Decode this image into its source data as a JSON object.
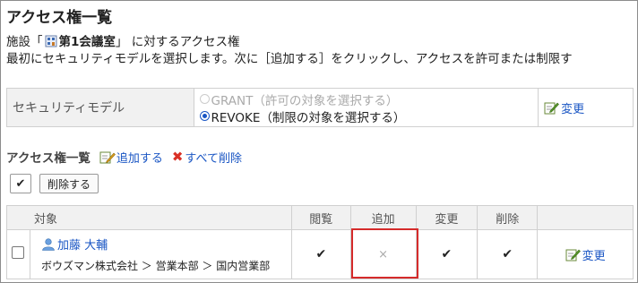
{
  "page": {
    "title": "アクセス権一覧",
    "facility_prefix": "施設「",
    "facility_name": "第1会議室",
    "facility_suffix": "」 に対するアクセス権",
    "instruction": "最初にセキュリティモデルを選択します。次に［追加する］をクリックし、アクセスを許可または制限す"
  },
  "security_model": {
    "label": "セキュリティモデル",
    "options": [
      {
        "label": "GRANT（許可の対象を選択する）",
        "selected": false,
        "disabled": true
      },
      {
        "label": "REVOKE（制限の対象を選択する）",
        "selected": true,
        "disabled": false
      }
    ],
    "change_label": "変更"
  },
  "acl": {
    "heading": "アクセス権一覧",
    "add_label": "追加する",
    "delete_all_label": "すべて削除",
    "check_all_symbol": "✔",
    "delete_button_label": "削除する",
    "columns": [
      "対象",
      "閲覧",
      "追加",
      "変更",
      "削除"
    ],
    "rows": [
      {
        "user_name": "加藤 大輔",
        "org_path": "ボウズマン株式会社 ＞ 営業本部 ＞ 国内営業部",
        "view": "✔",
        "add": "×",
        "change": "✔",
        "delete": "✔",
        "edit_label": "変更"
      }
    ]
  },
  "colors": {
    "link": "#1a56c4",
    "highlight": "#d52b2b",
    "header_bg": "#f1f1f1"
  },
  "icons": [
    "facility-icon",
    "edit-icon",
    "add-icon",
    "delete-all-icon",
    "user-icon",
    "check-icon",
    "cross-icon"
  ]
}
